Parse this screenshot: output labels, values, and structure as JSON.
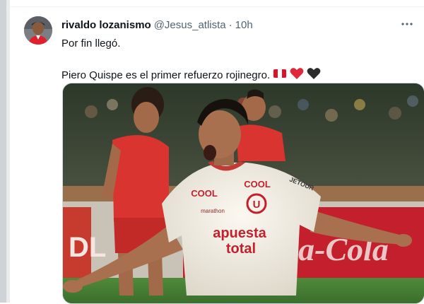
{
  "tweet": {
    "author_name": "rivaldo lozanismo",
    "handle": "@Jesus_atlista",
    "separator": "·",
    "time": "10h",
    "line1": "Por fin llegó.",
    "line2": "Piero Quispe es el primer refuerzo rojinegro.",
    "emojis": [
      "peru-flag",
      "red-heart",
      "black-heart"
    ],
    "more_icon": "more-horizontal-icon"
  },
  "media": {
    "jersey_sponsor_1": "apuesta",
    "jersey_sponsor_2": "total",
    "jersey_brand_left": "COOL",
    "jersey_brand_right": "COOL",
    "jersey_maker": "marathon",
    "crest_letter": "U",
    "sleeve_text": "JETOUR",
    "ad_board": "Coca-Cola"
  },
  "colors": {
    "accent_red": "#d9122a",
    "text_primary": "#0f1419",
    "text_secondary": "#536471"
  }
}
